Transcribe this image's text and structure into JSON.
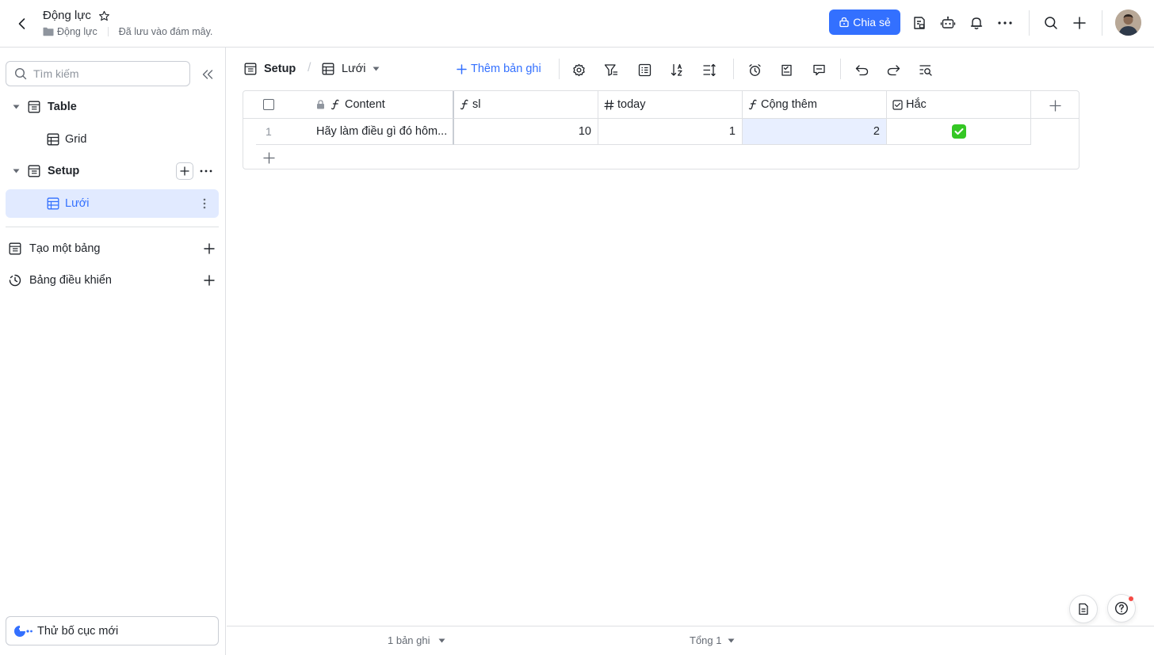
{
  "header": {
    "title": "Động lực",
    "breadcrumb_folder": "Động lực",
    "save_status": "Đã lưu vào đám mây.",
    "share_label": "Chia sẻ",
    "icons": [
      "back-icon",
      "star-icon",
      "template-icon",
      "bot-icon",
      "bell-icon",
      "more-icon",
      "search-icon",
      "plus-icon"
    ]
  },
  "sidebar": {
    "search_placeholder": "Tìm kiếm",
    "tree": [
      {
        "label": "Table",
        "level": 0,
        "type": "table"
      },
      {
        "label": "Grid",
        "level": 1,
        "type": "grid"
      },
      {
        "label": "Setup",
        "level": 0,
        "type": "table"
      },
      {
        "label": "Lưới",
        "level": 1,
        "type": "grid",
        "active": true
      }
    ],
    "create_table": "Tạo một bảng",
    "dashboard": "Bảng điều khiển",
    "new_layout": "Thử bố cục mới"
  },
  "viewbar": {
    "table_name": "Setup",
    "view_name": "Lưới",
    "add_record": "Thêm bản ghi"
  },
  "grid": {
    "columns": [
      {
        "name": "Content",
        "type": "formula",
        "locked": true
      },
      {
        "name": "sl",
        "type": "formula"
      },
      {
        "name": "today",
        "type": "number"
      },
      {
        "name": "Cộng thêm",
        "type": "formula"
      },
      {
        "name": "Hắc",
        "type": "checkbox"
      }
    ],
    "rows": [
      {
        "index": "1",
        "content": "Hãy làm điều gì đó hôm...",
        "sl": "10",
        "today": "1",
        "cong_them": "2",
        "hac": true
      }
    ]
  },
  "footer": {
    "record_count": "1 bản ghi",
    "total": "Tổng 1"
  },
  "colors": {
    "accent": "#3370ff",
    "active_bg": "#e1eaff",
    "selected_cell": "#e8efff",
    "checkbox_on": "#34c724"
  }
}
